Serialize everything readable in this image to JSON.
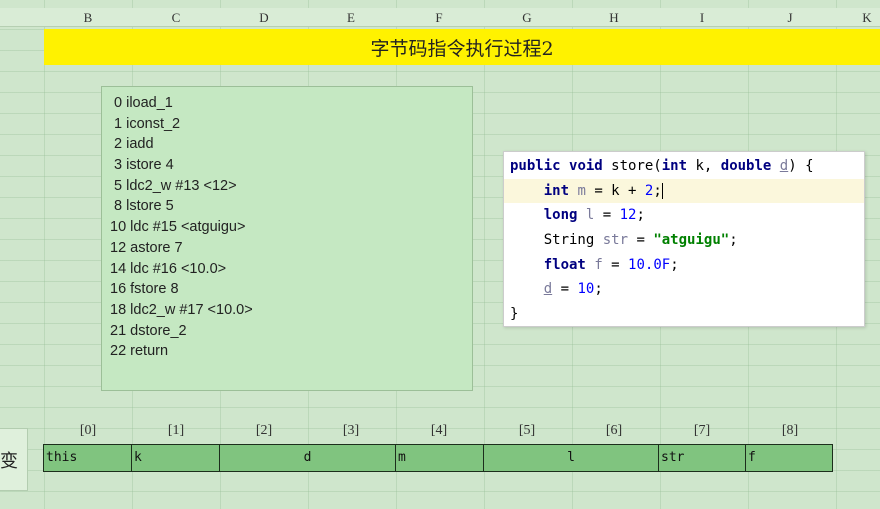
{
  "columns": [
    "B",
    "C",
    "D",
    "E",
    "F",
    "G",
    "H",
    "I",
    "J",
    "K"
  ],
  "title": "字节码指令执行过程2",
  "bytecode": [
    "0 iload_1",
    "1 iconst_2",
    "2 iadd",
    "3 istore 4",
    "5 ldc2_w #13 <12>",
    "8 lstore 5",
    "10 ldc #15 <atguigu>",
    "12 astore 7",
    "14 ldc #16 <10.0>",
    "16 fstore 8",
    "18 ldc2_w #17 <10.0>",
    "21 dstore_2",
    "22 return"
  ],
  "code": {
    "line1": {
      "kw1": "public",
      "kw2": "void",
      "name": " store(",
      "kw3": "int",
      "rest": " k, ",
      "kw4": "double",
      "sp": " ",
      "var": "d",
      "end": ") {"
    },
    "line2": {
      "kw": "int",
      "var": "m",
      "mid": " = k + ",
      "num": "2",
      "end": ";"
    },
    "line3": {
      "kw": "long",
      "var": "l",
      "mid": " = ",
      "num": "12",
      "end": ";"
    },
    "line4": {
      "type": "String",
      "var": "str",
      "mid": " = ",
      "str": "\"atguigu\"",
      "end": ";"
    },
    "line5": {
      "kw": "float",
      "var": "f",
      "mid": " = ",
      "num": "10.0F",
      "end": ";"
    },
    "line6": {
      "var": "d",
      "mid": " = ",
      "num": "10",
      "end": ";"
    },
    "line7": "}"
  },
  "local_table": {
    "indices": [
      "[0]",
      "[1]",
      "[2]",
      "[3]",
      "[4]",
      "[5]",
      "[6]",
      "[7]",
      "[8]"
    ],
    "slots": [
      "this",
      "k",
      "d",
      "m",
      "l",
      "str",
      "f"
    ]
  },
  "left_cell_text": "变"
}
